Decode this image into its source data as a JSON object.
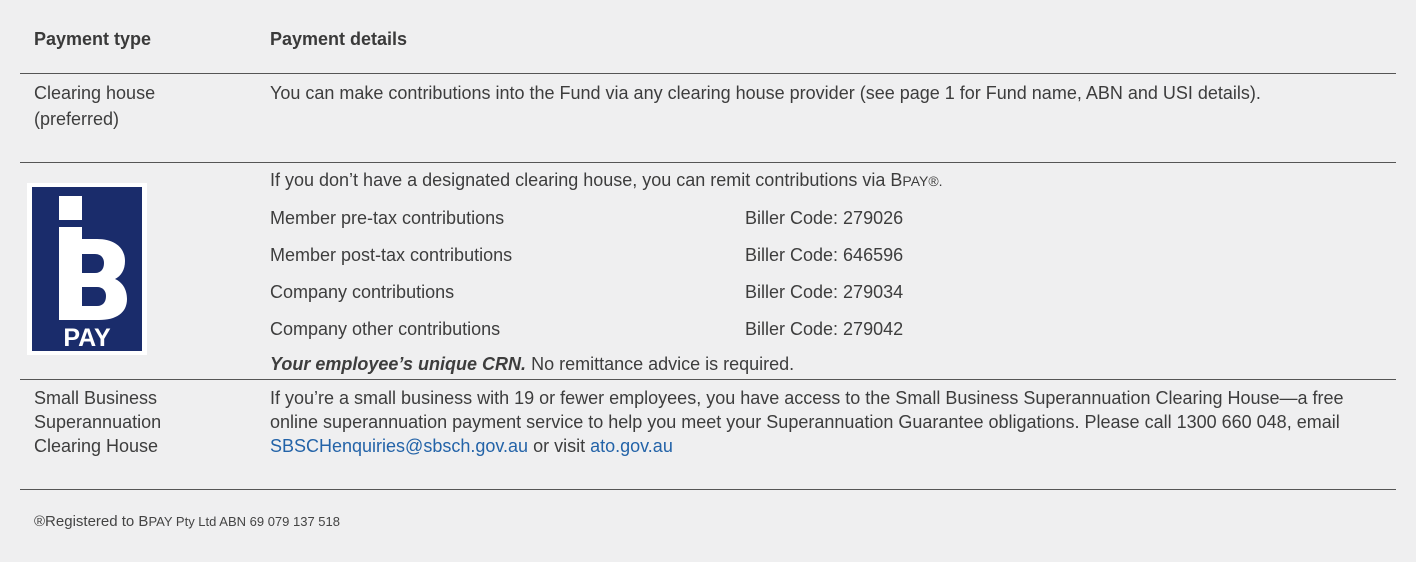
{
  "table": {
    "headers": {
      "type": "Payment type",
      "details": "Payment details"
    },
    "clearing_house": {
      "type_line1": "Clearing house",
      "type_line2": "(preferred)",
      "details": "You can make contributions into the Fund via any clearing house provider (see page 1 for Fund name, ABN and USI details)."
    },
    "bpay": {
      "logo_text": "PAY",
      "intro_prefix": "If you don’t have a designated clearing house, you can remit contributions via B",
      "intro_suffix": "PAY®.",
      "items": [
        {
          "label": "Member pre-tax contributions",
          "code": "Biller Code: 279026"
        },
        {
          "label": "Member post-tax contributions",
          "code": "Biller Code: 646596"
        },
        {
          "label": "Company contributions",
          "code": "Biller Code: 279034"
        },
        {
          "label": "Company other contributions",
          "code": "Biller Code: 279042"
        }
      ],
      "crn_bold": "Your employee’s unique CRN.",
      "crn_rest": " No remittance advice is required."
    },
    "sbsch": {
      "type_line1": "Small Business",
      "type_line2": "Superannuation",
      "type_line3": "Clearing House",
      "details_text": "If you’re a small business with 19 or fewer employees, you have access to the Small Business Superannuation Clearing House—a free online superannuation payment service to help you meet your Superannuation Guarantee obligations. Please call 1300 660 048, email ",
      "email_link": "SBSCHenquiries@sbsch.gov.au",
      "or_visit": " or visit ",
      "site_link": "ato.gov.au"
    }
  },
  "footnote": {
    "prefix": "®Registered to B",
    "suffix": "PAY Pty Ltd ABN 69 079 137 518"
  },
  "colors": {
    "logo_blue": "#1a2c6b",
    "link": "#2363a8",
    "background": "#efeff0"
  }
}
